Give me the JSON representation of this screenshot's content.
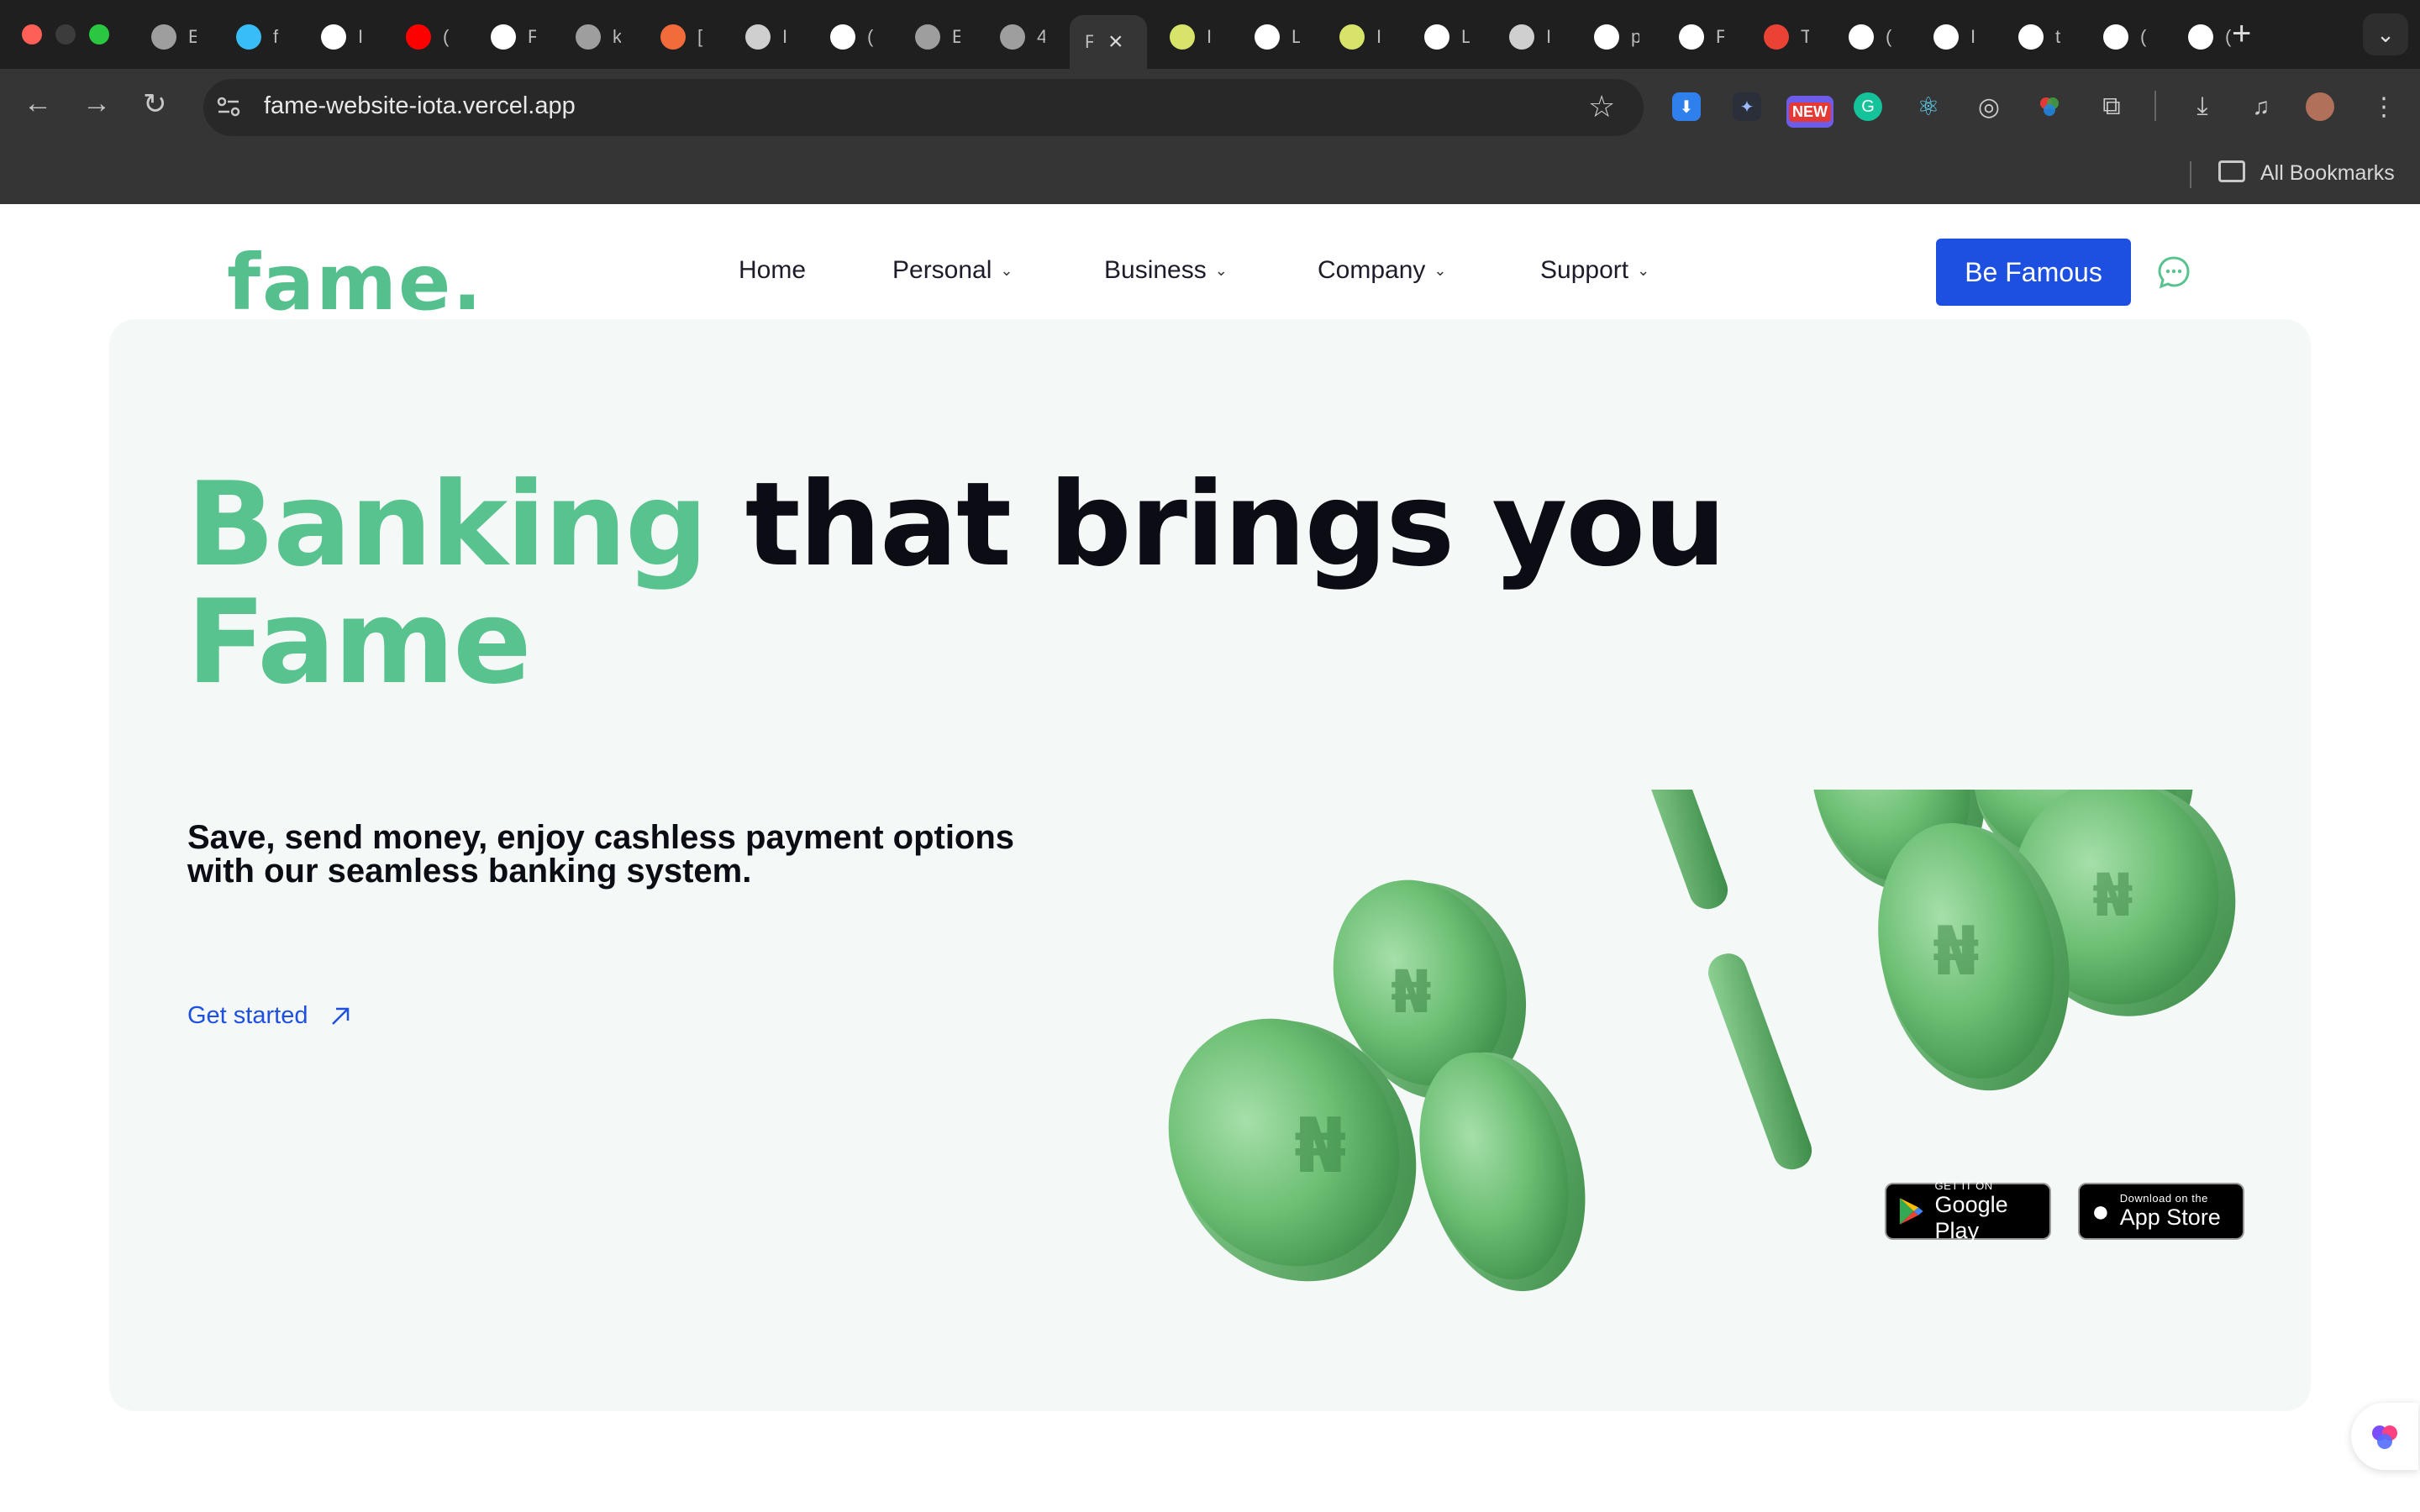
{
  "browser": {
    "tabs": [
      {
        "icon": "globe-icon",
        "title": "E"
      },
      {
        "icon": "tailwind-icon",
        "title": "f"
      },
      {
        "icon": "app-icon",
        "title": "I"
      },
      {
        "icon": "youtube-icon",
        "title": "("
      },
      {
        "icon": "github-icon",
        "title": "F"
      },
      {
        "icon": "globe-icon",
        "title": "k"
      },
      {
        "icon": "orange-icon",
        "title": "["
      },
      {
        "icon": "chrome-icon",
        "title": "I"
      },
      {
        "icon": "vercel-icon",
        "title": "("
      },
      {
        "icon": "globe-icon",
        "title": "E"
      },
      {
        "icon": "globe-icon",
        "title": "4"
      },
      {
        "icon": "fame-tab-icon",
        "title": "F",
        "active": true
      },
      {
        "icon": "stack-icon",
        "title": "I"
      },
      {
        "icon": "vercel-icon",
        "title": "L"
      },
      {
        "icon": "stack-icon",
        "title": "I"
      },
      {
        "icon": "github-icon",
        "title": "L"
      },
      {
        "icon": "chrome-icon",
        "title": "I"
      },
      {
        "icon": "google-icon",
        "title": "p"
      },
      {
        "icon": "openai-icon",
        "title": "F"
      },
      {
        "icon": "gmail-icon",
        "title": "T"
      },
      {
        "icon": "google-icon",
        "title": "("
      },
      {
        "icon": "vercel-icon",
        "title": "I"
      },
      {
        "icon": "vercel-icon",
        "title": "t"
      },
      {
        "icon": "vercel-icon",
        "title": "("
      },
      {
        "icon": "vercel-icon",
        "title": "("
      }
    ],
    "url": "fame-website-iota.vercel.app",
    "new_badge": "NEW",
    "bookmarks_label": "All Bookmarks"
  },
  "site": {
    "logo": "fame.",
    "nav": [
      {
        "label": "Home",
        "dropdown": false
      },
      {
        "label": "Personal",
        "dropdown": true
      },
      {
        "label": "Business",
        "dropdown": true
      },
      {
        "label": "Company",
        "dropdown": true
      },
      {
        "label": "Support",
        "dropdown": true
      }
    ],
    "cta": "Be Famous",
    "hero": {
      "headline_green_1": "Banking",
      "headline_dark": " that brings you",
      "headline_green_2": "Fame",
      "subtext": "Save, send money, enjoy cashless payment options with our seamless banking system.",
      "get_started": "Get started",
      "google_play_small": "GET IT ON",
      "google_play_big": "Google Play",
      "app_store_small": "Download on the",
      "app_store_big": "App Store"
    },
    "colors": {
      "brand_green": "#58c38f",
      "cta_blue": "#1d4fe0",
      "hero_bg": "#f4f9f7"
    }
  }
}
